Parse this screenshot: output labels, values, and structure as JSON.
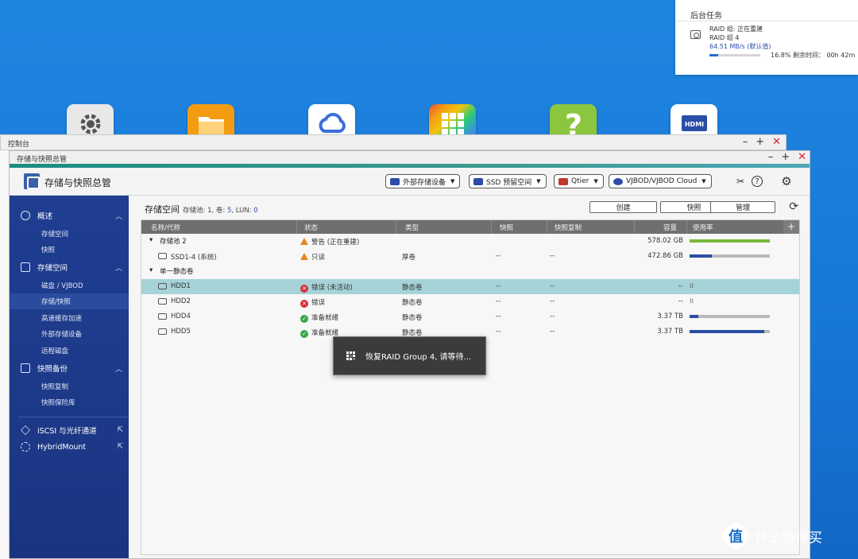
{
  "notification": {
    "title": "后台任务",
    "line1": "RAID 组: 正在重建",
    "line2": "RAID 组 4",
    "line3": "64.51 MB/s (默认值)",
    "progress_text": "16.8%  剩余时间： 00h 42m",
    "progress": 0.168
  },
  "desktop_icons": [
    {
      "name": "settings-app-icon",
      "color": "#e6e6e6"
    },
    {
      "name": "file-station-icon",
      "color": "#f39c12"
    },
    {
      "name": "cloud-app-icon",
      "color": "#ffffff"
    },
    {
      "name": "app-center-icon",
      "color": "#e74c3c"
    },
    {
      "name": "help-center-icon",
      "color": "#8cc63f"
    },
    {
      "name": "hdmi-app-icon",
      "color": "#ffffff"
    }
  ],
  "control_panel": {
    "title": "控制台"
  },
  "window": {
    "title": "存储与快照总管",
    "app_title": "存储与快照总管"
  },
  "toolbar": {
    "external_storage": "外部存储设备",
    "ssd_cache": "SSD 预留空间",
    "qtier": "Qtier",
    "vjbod": "VJBOD/VJBOD Cloud"
  },
  "sidebar": {
    "overview": "概述",
    "overview_items": [
      "存储空间",
      "快照"
    ],
    "storage": "存储空间",
    "storage_items": [
      "磁盘 / VJBOD",
      "存储/快照",
      "高速缓存加速",
      "外部存储设备",
      "远程磁盘"
    ],
    "snapshot_backup": "快照备份",
    "snapshot_items": [
      "快照复制",
      "快照保险库"
    ],
    "iscsi": "iSCSI 与光纤通道",
    "hybridmount": "HybridMount"
  },
  "content": {
    "title": "存储空间",
    "summary_prefix": "存储池: 1, 卷: ",
    "summary_vol": "5",
    "summary_mid": ", LUN: ",
    "summary_lun": "0",
    "btn_create": "创建",
    "btn_snapshot": "快照",
    "btn_manage": "管理"
  },
  "columns": [
    "名称/代称",
    "状态",
    "类型",
    "快照",
    "快照复制",
    "容量",
    "使用率"
  ],
  "rows": [
    {
      "kind": "group",
      "name": "存储池 2",
      "status": "警告 (正在重建)",
      "status_type": "warn",
      "type": "",
      "snap": "",
      "rep": "",
      "cap": "578.02 GB",
      "usage": 1.0,
      "usage_color": "#7ab83a"
    },
    {
      "kind": "item",
      "name": "SSD1-4 (系统)",
      "status": "只读",
      "status_type": "warn",
      "type": "厚卷",
      "snap": "--",
      "rep": "--",
      "cap": "472.86 GB",
      "usage": 0.28,
      "usage_color": "#2b4da6"
    },
    {
      "kind": "group",
      "name": "单一静态卷",
      "status": "",
      "status_type": "",
      "type": "",
      "snap": "",
      "rep": "",
      "cap": "",
      "usage": null
    },
    {
      "kind": "item",
      "name": "HDD1",
      "status": "错误 (未活动)",
      "status_type": "err",
      "type": "静态卷",
      "snap": "--",
      "rep": "--",
      "cap": "--",
      "usage": null,
      "selected": true
    },
    {
      "kind": "item",
      "name": "HDD2",
      "status": "错误",
      "status_type": "err",
      "type": "静态卷",
      "snap": "--",
      "rep": "--",
      "cap": "--",
      "usage": null
    },
    {
      "kind": "item",
      "name": "HDD4",
      "status": "准备就绪",
      "status_type": "ok",
      "type": "静态卷",
      "snap": "--",
      "rep": "--",
      "cap": "3.37 TB",
      "usage": 0.11,
      "usage_color": "#2b4da6"
    },
    {
      "kind": "item",
      "name": "HDD5",
      "status": "准备就绪",
      "status_type": "ok",
      "type": "静态卷",
      "snap": "--",
      "rep": "--",
      "cap": "3.37 TB",
      "usage": 0.93,
      "usage_color": "#2b4da6"
    }
  ],
  "toast": {
    "text": "恢复RAID Group 4, 请等待..."
  },
  "watermark": {
    "logo": "值",
    "text": "什么值得买"
  }
}
